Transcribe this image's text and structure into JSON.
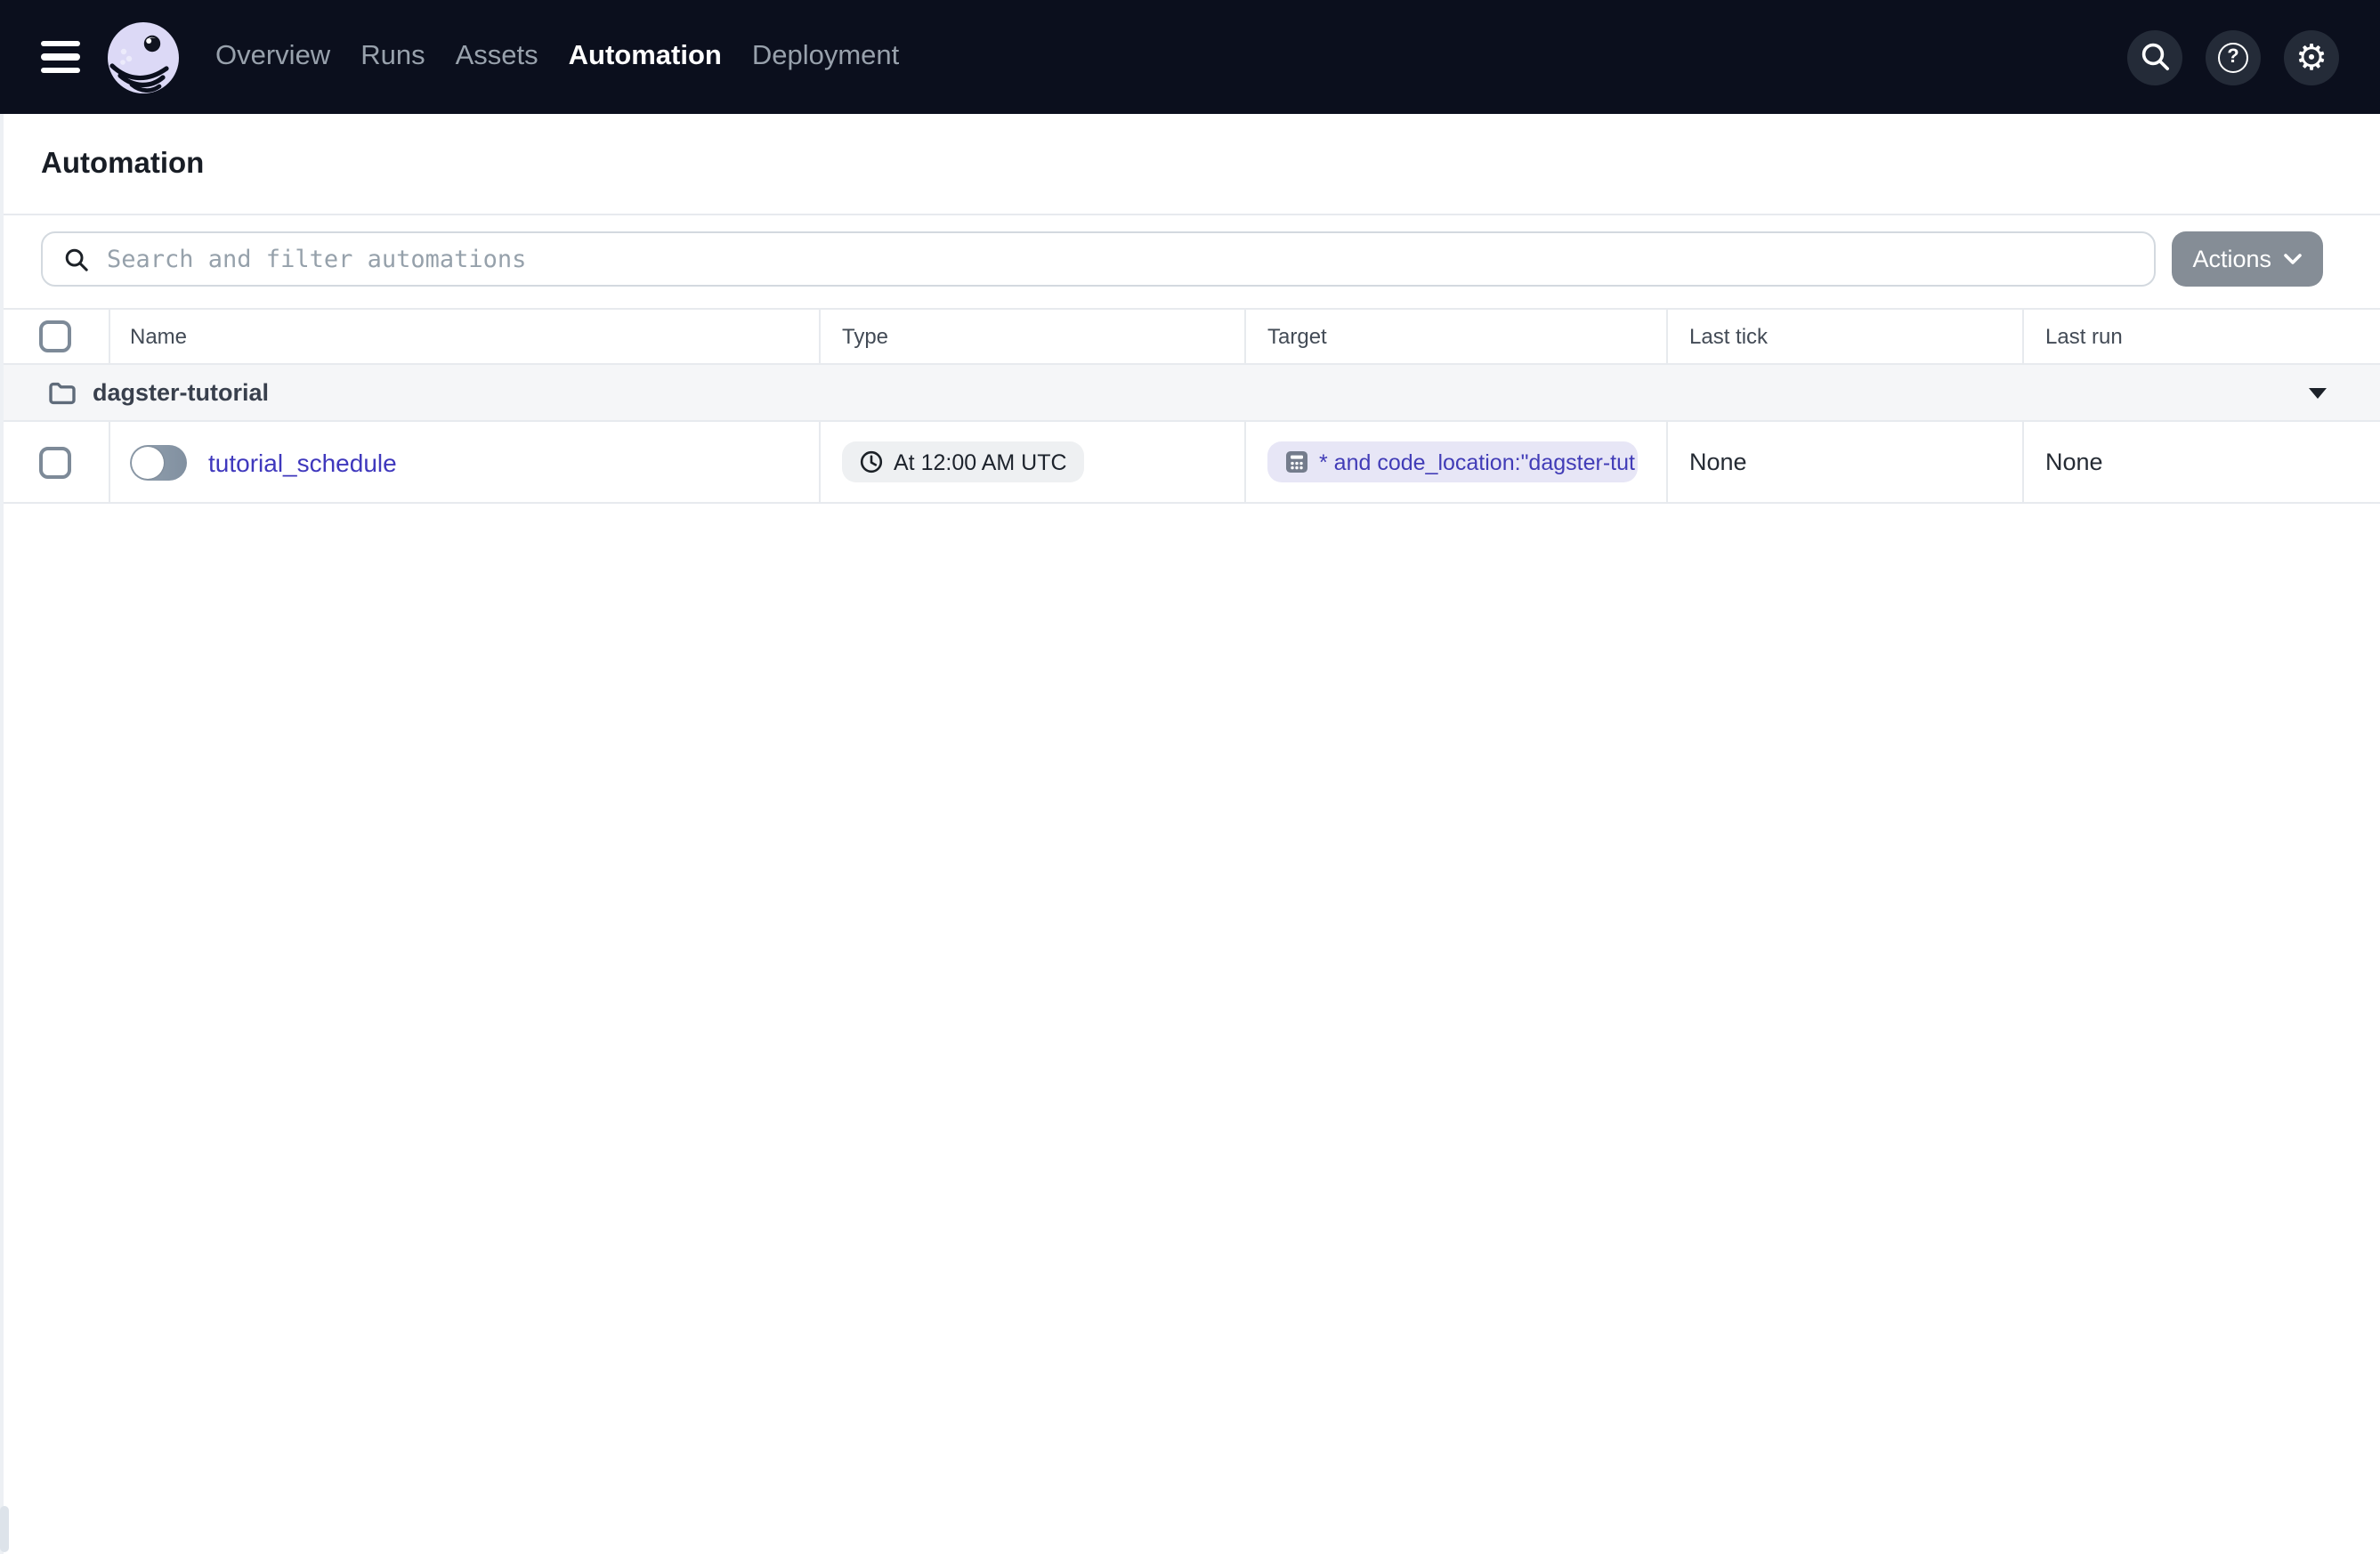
{
  "navbar": {
    "items": [
      {
        "label": "Overview"
      },
      {
        "label": "Runs"
      },
      {
        "label": "Assets"
      },
      {
        "label": "Automation"
      },
      {
        "label": "Deployment"
      }
    ],
    "active_item": "Automation",
    "icons": [
      "hamburger-icon",
      "dagster-octopus-logo",
      "search-icon",
      "help-icon",
      "gear-icon"
    ]
  },
  "page": {
    "title": "Automation"
  },
  "toolbar": {
    "search_placeholder": "Search and filter automations",
    "search_value": "",
    "actions_label": "Actions"
  },
  "table": {
    "columns": [
      {
        "label": "Name"
      },
      {
        "label": "Type"
      },
      {
        "label": "Target"
      },
      {
        "label": "Last tick"
      },
      {
        "label": "Last run"
      }
    ],
    "group": {
      "label": "dagster-tutorial",
      "expanded": true,
      "icon": "folder-icon"
    },
    "rows": [
      {
        "name": "tutorial_schedule",
        "toggle_state": "off",
        "type_label": "At 12:00 AM UTC",
        "type_icon": "clock-icon",
        "target_label": "* and code_location:\"dagster-tut",
        "target_icon": "selection-icon",
        "last_tick": "None",
        "last_run": "None"
      }
    ]
  },
  "colors": {
    "navbar_bg": "#0b0f1d",
    "accent_link": "#3f38bd",
    "badge_target_bg": "#e7e6f6",
    "badge_target_text": "#413cb7",
    "badge_type_bg": "#eef0f2",
    "group_row_bg": "#f5f6f8",
    "actions_button_bg": "#858d96",
    "divider": "#e7eaee",
    "logo_lavender": "#dcd9f6"
  }
}
